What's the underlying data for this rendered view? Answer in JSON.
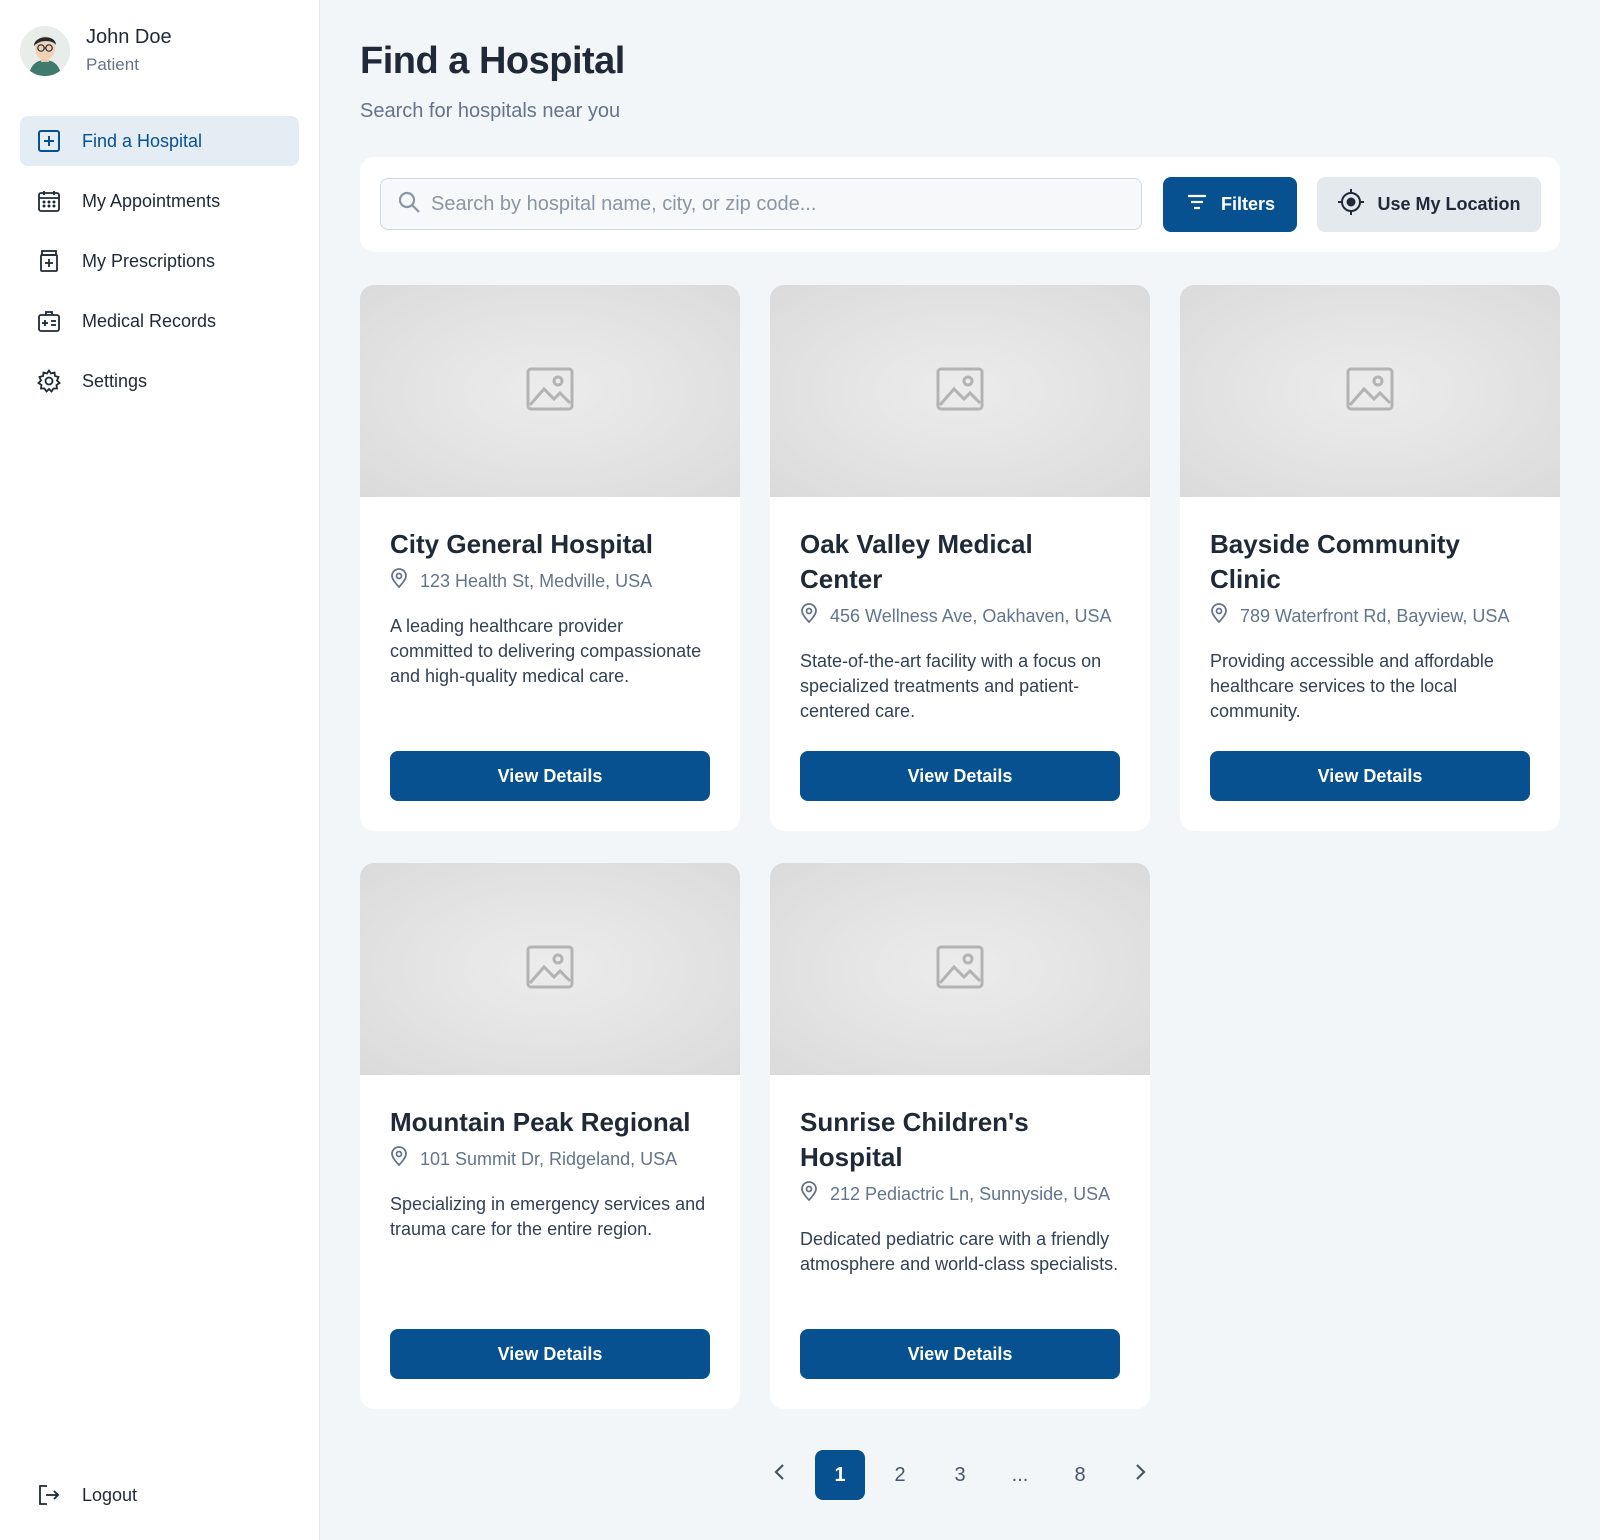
{
  "user": {
    "name": "John Doe",
    "role": "Patient"
  },
  "sidebar": {
    "items": [
      {
        "label": "Find a Hospital",
        "icon": "hospital-plus-icon",
        "active": true
      },
      {
        "label": "My Appointments",
        "icon": "calendar-icon",
        "active": false
      },
      {
        "label": "My Prescriptions",
        "icon": "prescription-icon",
        "active": false
      },
      {
        "label": "Medical Records",
        "icon": "medical-records-icon",
        "active": false
      },
      {
        "label": "Settings",
        "icon": "gear-icon",
        "active": false
      }
    ],
    "logout_label": "Logout"
  },
  "header": {
    "title": "Find a Hospital",
    "subtitle": "Search for hospitals near you"
  },
  "search": {
    "placeholder": "Search by hospital name, city, or zip code...",
    "value": "",
    "filters_label": "Filters",
    "location_label": "Use My Location"
  },
  "hospitals": [
    {
      "name": "City General Hospital",
      "address": "123 Health St, Medville, USA",
      "description": "A leading healthcare provider committed to delivering compassionate and high-quality medical care.",
      "button": "View Details"
    },
    {
      "name": "Oak Valley Medical Center",
      "address": "456 Wellness Ave, Oakhaven, USA",
      "description": "State-of-the-art facility with a focus on specialized treatments and patient-centered care.",
      "button": "View Details"
    },
    {
      "name": "Bayside Community Clinic",
      "address": "789 Waterfront Rd, Bayview, USA",
      "description": "Providing accessible and affordable healthcare services to the local community.",
      "button": "View Details"
    },
    {
      "name": "Mountain Peak Regional",
      "address": "101 Summit Dr, Ridgeland, USA",
      "description": "Specializing in emergency services and trauma care for the entire region.",
      "button": "View Details"
    },
    {
      "name": "Sunrise Children's Hospital",
      "address": "212 Pediactric Ln, Sunnyside, USA",
      "description": "Dedicated pediatric care with a friendly atmosphere and world-class specialists.",
      "button": "View Details"
    }
  ],
  "pagination": {
    "prev_icon": "chevron-left-icon",
    "next_icon": "chevron-right-icon",
    "pages": [
      "1",
      "2",
      "3",
      "...",
      "8"
    ],
    "current": "1"
  },
  "colors": {
    "primary": "#075190",
    "active_nav_bg": "#e4ecf4",
    "page_bg": "#f3f6f9"
  }
}
